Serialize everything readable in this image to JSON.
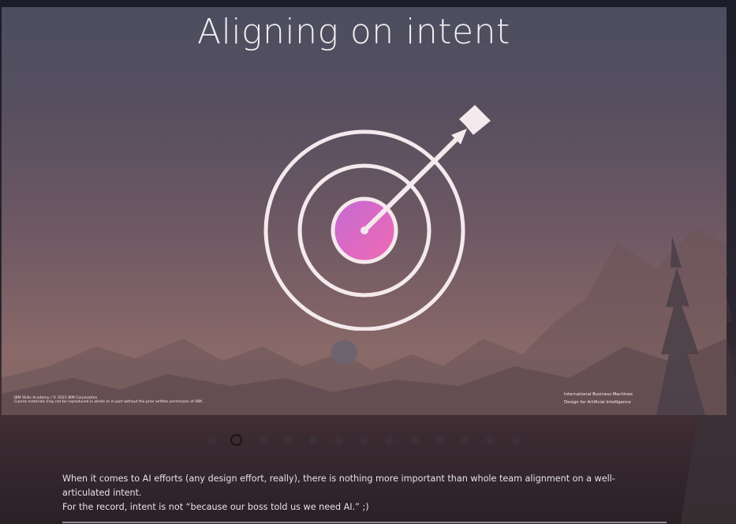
{
  "slide": {
    "title": "Aligning on intent",
    "footer_left_line1": "IBM Skills Academy / © 2021 IBM Corporation",
    "footer_left_line2": "Course materials may not be reproduced in whole or in part without the prior written permission of IBM.",
    "footer_right_line1": "International Business Machines",
    "footer_right_line2": "Design for Artificial Intelligence",
    "icon": "target-with-arrow-icon"
  },
  "pager": {
    "count": 13,
    "active_index": 1
  },
  "caption": {
    "line1": "When it comes to AI efforts (any design effort, really), there is nothing more important than whole team alignment on a well-articulated intent.",
    "line2": "For the record, intent is not “because our boss told us we need AI.” ;)"
  },
  "colors": {
    "target_ring": "#f4e9ec",
    "bullseye_start": "#c46ad6",
    "bullseye_end": "#f06ab0"
  }
}
